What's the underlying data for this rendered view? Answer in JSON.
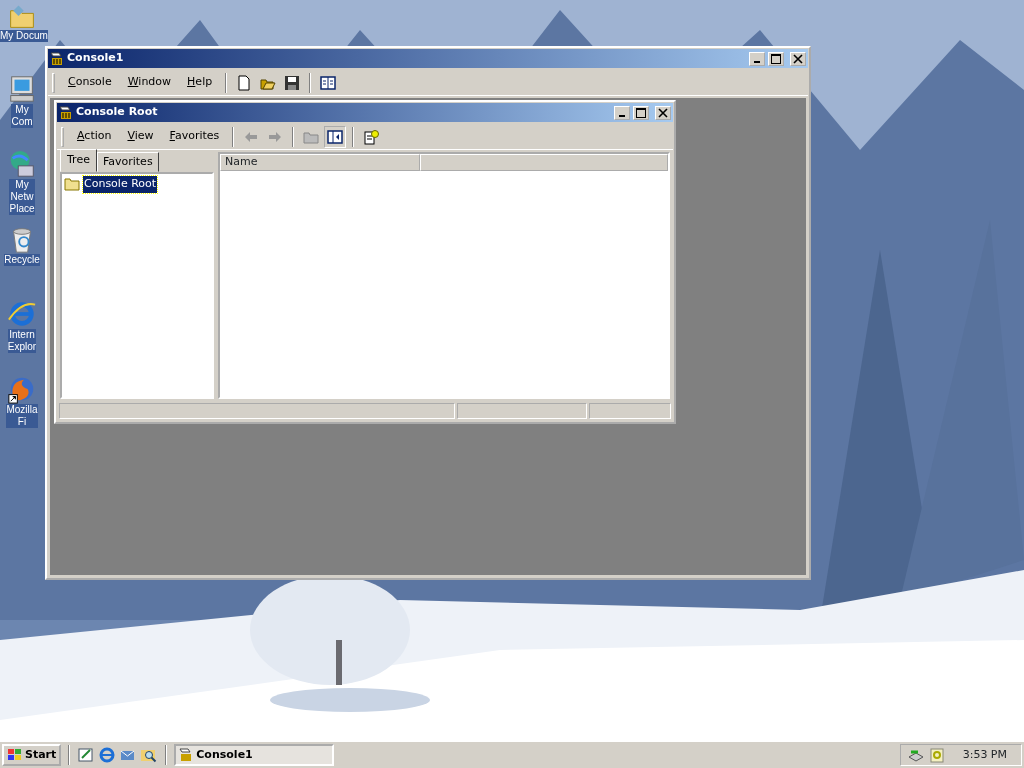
{
  "desktop_icons": [
    {
      "kind": "documents",
      "label": "My Docum"
    },
    {
      "kind": "computer",
      "label": "My Com"
    },
    {
      "kind": "network",
      "label": "My Netw Place"
    },
    {
      "kind": "recycle",
      "label": "Recycle"
    },
    {
      "kind": "ie",
      "label": "Intern Explor"
    },
    {
      "kind": "firefox",
      "label": "Mozilla Fi"
    }
  ],
  "window": {
    "title": "Console1",
    "menu": [
      "Console",
      "Window",
      "Help"
    ],
    "child_window": {
      "title": "Console Root",
      "menu": [
        "Action",
        "View",
        "Favorites"
      ],
      "tabs": [
        {
          "label": "Tree",
          "selected": true
        },
        {
          "label": "Favorites",
          "selected": false
        }
      ],
      "tree": [
        {
          "label": "Console Root",
          "selected": true
        }
      ],
      "list_columns": [
        "Name"
      ]
    }
  },
  "taskbar": {
    "start": "Start",
    "tasks": [
      {
        "label": "Console1",
        "selected": true
      }
    ],
    "clock": "3:53 PM"
  }
}
